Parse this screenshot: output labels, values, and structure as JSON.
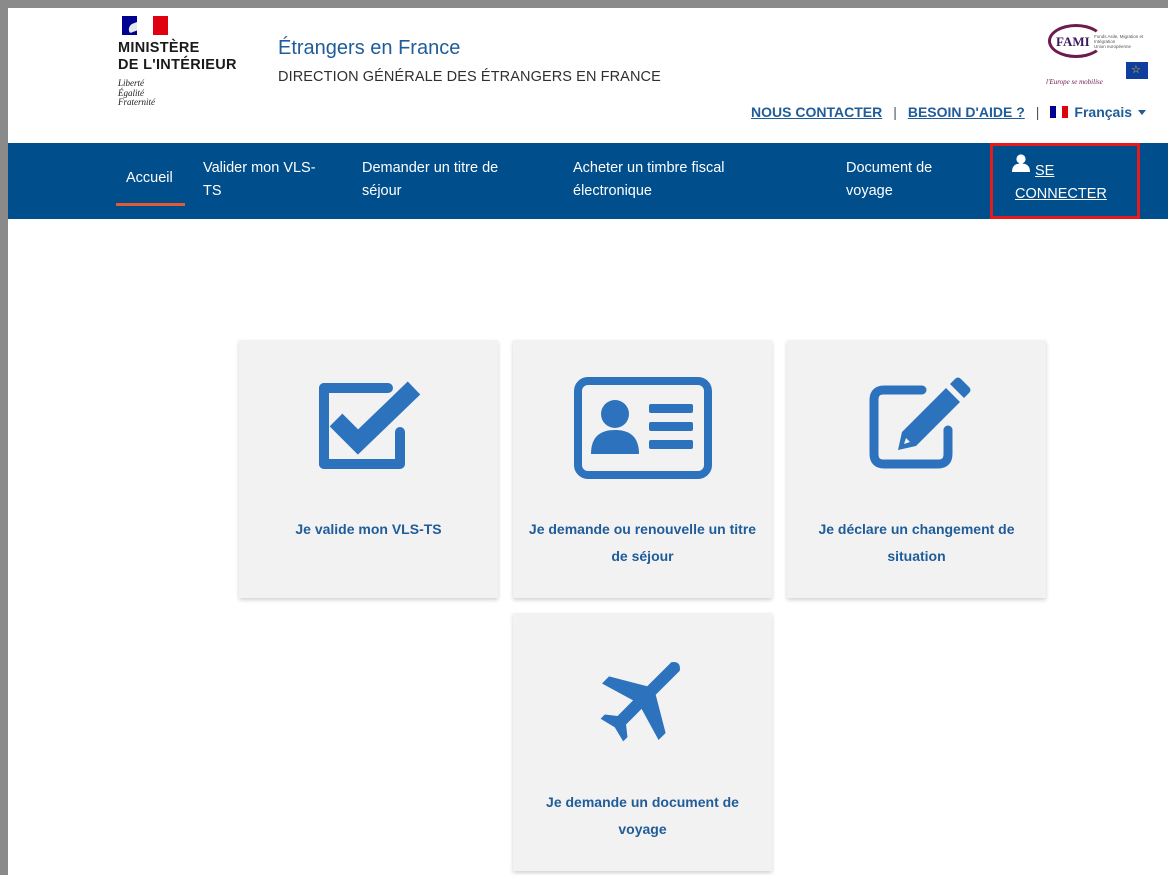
{
  "header": {
    "logo": {
      "ministere_line1": "MINISTÈRE",
      "ministere_line2": "DE L'INTÉRIEUR",
      "devise": [
        "Liberté",
        "Égalité",
        "Fraternité"
      ]
    },
    "site_title": "Étrangers en France",
    "site_subtitle": "DIRECTION GÉNÉRALE DES ÉTRANGERS EN FRANCE",
    "fami": {
      "name": "FAMI",
      "small_text": "Fonds Asile, Migration et Intégration",
      "small_eu": "Union européenne",
      "slogan": "l'Europe se mobilise"
    },
    "links": {
      "contact": "NOUS CONTACTER",
      "separator": "|",
      "help": "BESOIN D'AIDE ?",
      "language": "Français"
    }
  },
  "nav": {
    "items": [
      {
        "line1": "Accueil",
        "line2": ""
      },
      {
        "line1": "Valider mon VLS-",
        "line2": "TS"
      },
      {
        "line1": "Demander un titre de",
        "line2": "séjour"
      },
      {
        "line1": "Acheter un timbre fiscal",
        "line2": "électronique"
      },
      {
        "line1": "Document de",
        "line2": "voyage"
      }
    ],
    "login": {
      "line1": "SE",
      "line2": "CONNECTER"
    }
  },
  "cards": [
    {
      "icon": "checkbox-check-icon",
      "line1": "Je valide mon VLS-TS",
      "line2": ""
    },
    {
      "icon": "id-card-icon",
      "line1": "Je demande ou renouvelle un titre",
      "line2": "de séjour"
    },
    {
      "icon": "edit-pencil-icon",
      "line1": "Je déclare un changement de",
      "line2": "situation"
    },
    {
      "icon": "airplane-icon",
      "line1": "Je demande un document de",
      "line2": "voyage"
    }
  ],
  "colors": {
    "nav_bg": "#004e8c",
    "accent_blue": "#1f5c99",
    "icon_blue": "#2d72bd",
    "active_underline": "#e35c31",
    "highlight_border": "#e31b1b"
  }
}
